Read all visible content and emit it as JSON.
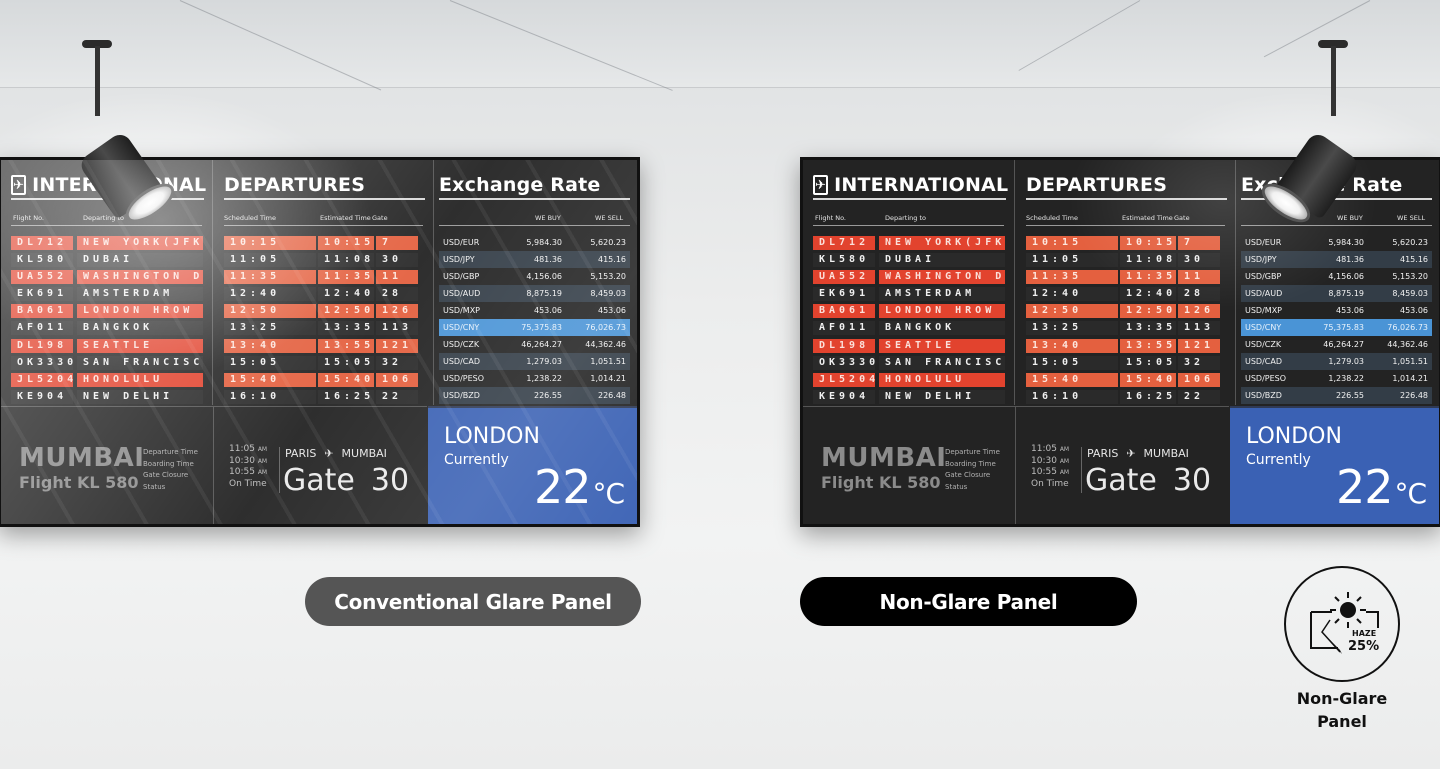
{
  "board": {
    "title_international": "INTERNATIONAL",
    "title_departures": "DEPARTURES",
    "title_exchange": "Exchange Rate",
    "col_flight": "Flight No.",
    "col_departing": "Departing to",
    "col_scheduled": "Scheduled Time",
    "col_estimated": "Estimated Time",
    "col_gate": "Gate",
    "col_buy": "WE BUY",
    "col_sell": "WE SELL",
    "flights": [
      {
        "flight": "DL712",
        "dest": "NEW YORK(JFK)",
        "sched": "10:15",
        "est": "10:15",
        "gate": "7",
        "highlight": true
      },
      {
        "flight": "KL580",
        "dest": "DUBAI",
        "sched": "11:05",
        "est": "11:08",
        "gate": "30",
        "highlight": false
      },
      {
        "flight": "UA552",
        "dest": "WASHINGTON DC",
        "sched": "11:35",
        "est": "11:35",
        "gate": "11",
        "highlight": true
      },
      {
        "flight": "EK691",
        "dest": "AMSTERDAM",
        "sched": "12:40",
        "est": "12:40",
        "gate": "28",
        "highlight": false
      },
      {
        "flight": "BA061",
        "dest": "LONDON HROW",
        "sched": "12:50",
        "est": "12:50",
        "gate": "126",
        "highlight": true
      },
      {
        "flight": "AF011",
        "dest": "BANGKOK",
        "sched": "13:25",
        "est": "13:35",
        "gate": "113",
        "highlight": false
      },
      {
        "flight": "DL198",
        "dest": "SEATTLE",
        "sched": "13:40",
        "est": "13:55",
        "gate": "121",
        "highlight": true
      },
      {
        "flight": "OK3330",
        "dest": "SAN FRANCISCO",
        "sched": "15:05",
        "est": "15:05",
        "gate": "32",
        "highlight": false
      },
      {
        "flight": "JL5204",
        "dest": "HONOLULU",
        "sched": "15:40",
        "est": "15:40",
        "gate": "106",
        "highlight": true
      },
      {
        "flight": "KE904",
        "dest": "NEW DELHI",
        "sched": "16:10",
        "est": "16:25",
        "gate": "22",
        "highlight": false
      }
    ],
    "rates": [
      {
        "pair": "USD/EUR",
        "buy": "5,984.30",
        "sell": "5,620.23",
        "style": "plain"
      },
      {
        "pair": "USD/JPY",
        "buy": "481.36",
        "sell": "415.16",
        "style": "alt"
      },
      {
        "pair": "USD/GBP",
        "buy": "4,156.06",
        "sell": "5,153.20",
        "style": "plain"
      },
      {
        "pair": "USD/AUD",
        "buy": "8,875.19",
        "sell": "8,459.03",
        "style": "alt"
      },
      {
        "pair": "USD/MXP",
        "buy": "453.06",
        "sell": "453.06",
        "style": "plain"
      },
      {
        "pair": "USD/CNY",
        "buy": "75,375.83",
        "sell": "76,026.73",
        "style": "hl"
      },
      {
        "pair": "USD/CZK",
        "buy": "46,264.27",
        "sell": "44,362.46",
        "style": "plain"
      },
      {
        "pair": "USD/CAD",
        "buy": "1,279.03",
        "sell": "1,051.51",
        "style": "alt"
      },
      {
        "pair": "USD/PESO",
        "buy": "1,238.22",
        "sell": "1,014.21",
        "style": "plain"
      },
      {
        "pair": "USD/BZD",
        "buy": "226.55",
        "sell": "226.48",
        "style": "alt"
      }
    ],
    "featured": {
      "city": "MUMBAI",
      "flight": "Flight KL 580",
      "labels": [
        "Departure Time",
        "Boarding Time",
        "Gate Closure",
        "Status"
      ],
      "values": [
        {
          "time": "11:05",
          "suffix": "AM"
        },
        {
          "time": "10:30",
          "suffix": "AM"
        },
        {
          "time": "10:55",
          "suffix": "AM"
        },
        {
          "time": "On Time",
          "suffix": ""
        }
      ],
      "from": "PARIS",
      "to": "MUMBAI",
      "gate_label": "Gate",
      "gate_number": "30"
    },
    "weather": {
      "city": "LONDON",
      "label": "Currently",
      "temp": "22",
      "unit": "°C"
    }
  },
  "labels": {
    "left_panel": "Conventional Glare Panel",
    "right_panel": "Non-Glare Panel"
  },
  "badge": {
    "haze_label": "HAZE",
    "haze_value": "25%",
    "caption_line1": "Non-Glare",
    "caption_line2": "Panel"
  },
  "colors": {
    "row_red": "#e2432e",
    "row_orange": "#e4603f",
    "fx_highlight": "#4a94d6",
    "weather_blue": "#3a61b4",
    "pill_gray": "#555555",
    "pill_black": "#000000"
  }
}
